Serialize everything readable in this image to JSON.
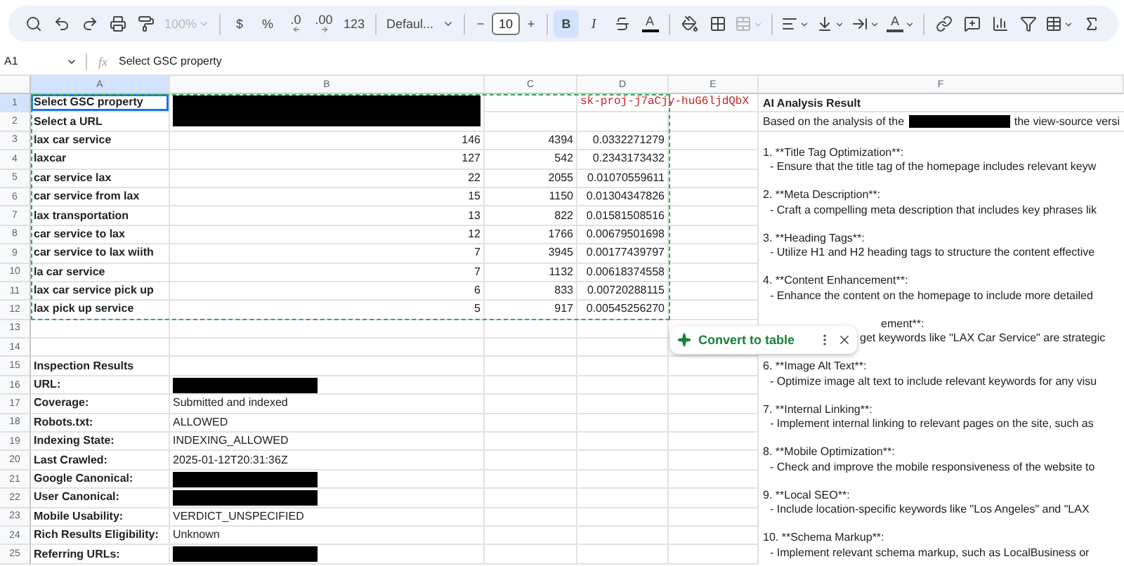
{
  "toolbar": {
    "zoom": {
      "label": "100%",
      "disabled": true
    },
    "currency": "$",
    "percent": "%",
    "decrease_decimals": ".0",
    "increase_decimals": ".00",
    "number_format": "123",
    "font": "Defaul...",
    "minus": "−",
    "font_size": "10",
    "plus": "+",
    "bold": {
      "label": "B",
      "selected": true
    },
    "italic": "I",
    "text_color": "A",
    "merge_disabled": true,
    "rotate": "A"
  },
  "formula_bar": {
    "cell": "A1",
    "fx": "fx",
    "content": "Select GSC property"
  },
  "columns": [
    {
      "label": "A",
      "selected": true
    },
    {
      "label": "B",
      "selected": false
    },
    {
      "label": "C",
      "selected": false
    },
    {
      "label": "D",
      "selected": false
    },
    {
      "label": "E",
      "selected": false
    },
    {
      "label": "F",
      "selected": false
    }
  ],
  "rows": [
    {
      "number": "1",
      "selected": true,
      "cells": [
        {
          "kind": "label",
          "text": "Select GSC property"
        },
        {
          "kind": "redacted-merged"
        },
        {
          "kind": "empty"
        },
        {
          "kind": "key",
          "text": "sk-proj-j7aCjy-huG6ljdQbX"
        }
      ]
    },
    {
      "number": "2",
      "selected": false,
      "cells": [
        {
          "kind": "label",
          "text": "Select a URL"
        },
        {
          "kind": "empty"
        },
        {
          "kind": "empty"
        },
        {
          "kind": "empty"
        }
      ]
    },
    {
      "number": "3",
      "selected": false,
      "cells": [
        {
          "kind": "label",
          "text": "lax car service"
        },
        {
          "kind": "number",
          "text": "146"
        },
        {
          "kind": "number",
          "text": "4394"
        },
        {
          "kind": "number",
          "text": "0.0332271279"
        },
        {
          "kind": "empty"
        }
      ]
    },
    {
      "number": "4",
      "selected": false,
      "cells": [
        {
          "kind": "label",
          "text": "laxcar"
        },
        {
          "kind": "number",
          "text": "127"
        },
        {
          "kind": "number",
          "text": "542"
        },
        {
          "kind": "number",
          "text": "0.2343173432"
        },
        {
          "kind": "empty"
        }
      ]
    },
    {
      "number": "5",
      "selected": false,
      "cells": [
        {
          "kind": "label",
          "text": "car service lax"
        },
        {
          "kind": "number",
          "text": "22"
        },
        {
          "kind": "number",
          "text": "2055"
        },
        {
          "kind": "number",
          "text": "0.01070559611"
        },
        {
          "kind": "empty"
        }
      ]
    },
    {
      "number": "6",
      "selected": false,
      "cells": [
        {
          "kind": "label",
          "text": "car service from lax"
        },
        {
          "kind": "number",
          "text": "15"
        },
        {
          "kind": "number",
          "text": "1150"
        },
        {
          "kind": "number",
          "text": "0.01304347826"
        },
        {
          "kind": "empty"
        }
      ]
    },
    {
      "number": "7",
      "selected": false,
      "cells": [
        {
          "kind": "label",
          "text": "lax transportation"
        },
        {
          "kind": "number",
          "text": "13"
        },
        {
          "kind": "number",
          "text": "822"
        },
        {
          "kind": "number",
          "text": "0.01581508516"
        },
        {
          "kind": "empty"
        }
      ]
    },
    {
      "number": "8",
      "selected": false,
      "cells": [
        {
          "kind": "label",
          "text": "car service to lax"
        },
        {
          "kind": "number",
          "text": "12"
        },
        {
          "kind": "number",
          "text": "1766"
        },
        {
          "kind": "number",
          "text": "0.00679501698"
        },
        {
          "kind": "empty"
        }
      ]
    },
    {
      "number": "9",
      "selected": false,
      "cells": [
        {
          "kind": "label",
          "text": "car service to lax wiith"
        },
        {
          "kind": "number",
          "text": "7"
        },
        {
          "kind": "number",
          "text": "3945"
        },
        {
          "kind": "number",
          "text": "0.00177439797"
        },
        {
          "kind": "empty"
        }
      ]
    },
    {
      "number": "10",
      "selected": false,
      "cells": [
        {
          "kind": "label",
          "text": "la car service"
        },
        {
          "kind": "number",
          "text": "7"
        },
        {
          "kind": "number",
          "text": "1132"
        },
        {
          "kind": "number",
          "text": "0.00618374558"
        },
        {
          "kind": "empty"
        }
      ]
    },
    {
      "number": "11",
      "selected": false,
      "cells": [
        {
          "kind": "label",
          "text": "lax car service pick up"
        },
        {
          "kind": "number",
          "text": "6"
        },
        {
          "kind": "number",
          "text": "833"
        },
        {
          "kind": "number",
          "text": "0.00720288115"
        },
        {
          "kind": "empty"
        }
      ]
    },
    {
      "number": "12",
      "selected": false,
      "cells": [
        {
          "kind": "label",
          "text": "lax pick up service"
        },
        {
          "kind": "number",
          "text": "5"
        },
        {
          "kind": "number",
          "text": "917"
        },
        {
          "kind": "number",
          "text": "0.00545256270"
        },
        {
          "kind": "empty"
        }
      ]
    },
    {
      "number": "13",
      "selected": false,
      "cells": [
        {
          "kind": "empty"
        },
        {
          "kind": "empty"
        },
        {
          "kind": "empty"
        },
        {
          "kind": "empty"
        },
        {
          "kind": "empty"
        }
      ]
    },
    {
      "number": "14",
      "selected": false,
      "cells": [
        {
          "kind": "empty"
        },
        {
          "kind": "empty"
        },
        {
          "kind": "empty"
        },
        {
          "kind": "empty"
        },
        {
          "kind": "empty"
        }
      ]
    },
    {
      "number": "15",
      "selected": false,
      "cells": [
        {
          "kind": "label",
          "text": "Inspection Results"
        },
        {
          "kind": "empty"
        },
        {
          "kind": "empty"
        },
        {
          "kind": "empty"
        },
        {
          "kind": "empty"
        }
      ]
    },
    {
      "number": "16",
      "selected": false,
      "cells": [
        {
          "kind": "label",
          "text": "URL:"
        },
        {
          "kind": "redacted"
        },
        {
          "kind": "empty"
        },
        {
          "kind": "empty"
        },
        {
          "kind": "empty"
        }
      ]
    },
    {
      "number": "17",
      "selected": false,
      "cells": [
        {
          "kind": "label",
          "text": "Coverage:"
        },
        {
          "kind": "text",
          "text": "Submitted and indexed"
        },
        {
          "kind": "empty"
        },
        {
          "kind": "empty"
        },
        {
          "kind": "empty"
        }
      ]
    },
    {
      "number": "18",
      "selected": false,
      "cells": [
        {
          "kind": "label",
          "text": "Robots.txt:"
        },
        {
          "kind": "text",
          "text": "ALLOWED"
        },
        {
          "kind": "empty"
        },
        {
          "kind": "empty"
        },
        {
          "kind": "empty"
        }
      ]
    },
    {
      "number": "19",
      "selected": false,
      "cells": [
        {
          "kind": "label",
          "text": "Indexing State:"
        },
        {
          "kind": "text",
          "text": "INDEXING_ALLOWED"
        },
        {
          "kind": "empty"
        },
        {
          "kind": "empty"
        },
        {
          "kind": "empty"
        }
      ]
    },
    {
      "number": "20",
      "selected": false,
      "cells": [
        {
          "kind": "label",
          "text": "Last Crawled:"
        },
        {
          "kind": "text",
          "text": "2025-01-12T20:31:36Z"
        },
        {
          "kind": "empty"
        },
        {
          "kind": "empty"
        },
        {
          "kind": "empty"
        }
      ]
    },
    {
      "number": "21",
      "selected": false,
      "cells": [
        {
          "kind": "label",
          "text": "Google Canonical:"
        },
        {
          "kind": "redacted"
        },
        {
          "kind": "empty"
        },
        {
          "kind": "empty"
        },
        {
          "kind": "empty"
        }
      ]
    },
    {
      "number": "22",
      "selected": false,
      "cells": [
        {
          "kind": "label",
          "text": "User Canonical:"
        },
        {
          "kind": "redacted"
        },
        {
          "kind": "empty"
        },
        {
          "kind": "empty"
        },
        {
          "kind": "empty"
        }
      ]
    },
    {
      "number": "23",
      "selected": false,
      "cells": [
        {
          "kind": "label",
          "text": "Mobile Usability:"
        },
        {
          "kind": "text",
          "text": "VERDICT_UNSPECIFIED"
        },
        {
          "kind": "empty"
        },
        {
          "kind": "empty"
        },
        {
          "kind": "empty"
        }
      ]
    },
    {
      "number": "24",
      "selected": false,
      "cells": [
        {
          "kind": "label",
          "text": "Rich Results Eligibility:"
        },
        {
          "kind": "text",
          "text": "Unknown"
        },
        {
          "kind": "empty"
        },
        {
          "kind": "empty"
        },
        {
          "kind": "empty"
        }
      ]
    },
    {
      "number": "25",
      "selected": false,
      "cells": [
        {
          "kind": "label",
          "text": "Referring URLs:"
        },
        {
          "kind": "redacted"
        },
        {
          "kind": "empty"
        },
        {
          "kind": "empty"
        },
        {
          "kind": "empty"
        }
      ]
    }
  ],
  "analysis": {
    "title": "AI Analysis Result",
    "intro_before": "Based on the analysis of the",
    "intro_after": "the view-source versi",
    "items": [
      {
        "kind": "full",
        "heading": "1. **Title Tag Optimization**:",
        "body": "- Ensure that the title tag of the homepage includes relevant keyw"
      },
      {
        "kind": "full",
        "heading": "2. **Meta Description**:",
        "body": "- Craft a compelling meta description that includes key phrases lik"
      },
      {
        "kind": "full",
        "heading": "3. **Heading Tags**:",
        "body": "- Utilize H1 and H2 heading tags to structure the content effective"
      },
      {
        "kind": "full",
        "heading": "4. **Content Enhancement**:",
        "body": "- Enhance the content on the homepage to include more detailed"
      },
      {
        "kind": "covered",
        "heading": "ement**:",
        "body": "get keywords like \"LAX Car Service\" are strategic"
      },
      {
        "kind": "full",
        "heading": "6. **Image Alt Text**:",
        "body": "- Optimize image alt text to include relevant keywords for any visu"
      },
      {
        "kind": "full",
        "heading": "7. **Internal Linking**:",
        "body": "- Implement internal linking to relevant pages on the site, such as"
      },
      {
        "kind": "full",
        "heading": "8. **Mobile Optimization**:",
        "body": "- Check and improve the mobile responsiveness of the website to"
      },
      {
        "kind": "full",
        "heading": "9. **Local SEO**:",
        "body": "- Include location-specific keywords like \"Los Angeles\" and \"LAX"
      },
      {
        "kind": "full",
        "heading": "10. **Schema Markup**:",
        "body": "- Implement relevant schema markup, such as LocalBusiness or"
      }
    ]
  },
  "popup": {
    "label": "Convert to table"
  }
}
